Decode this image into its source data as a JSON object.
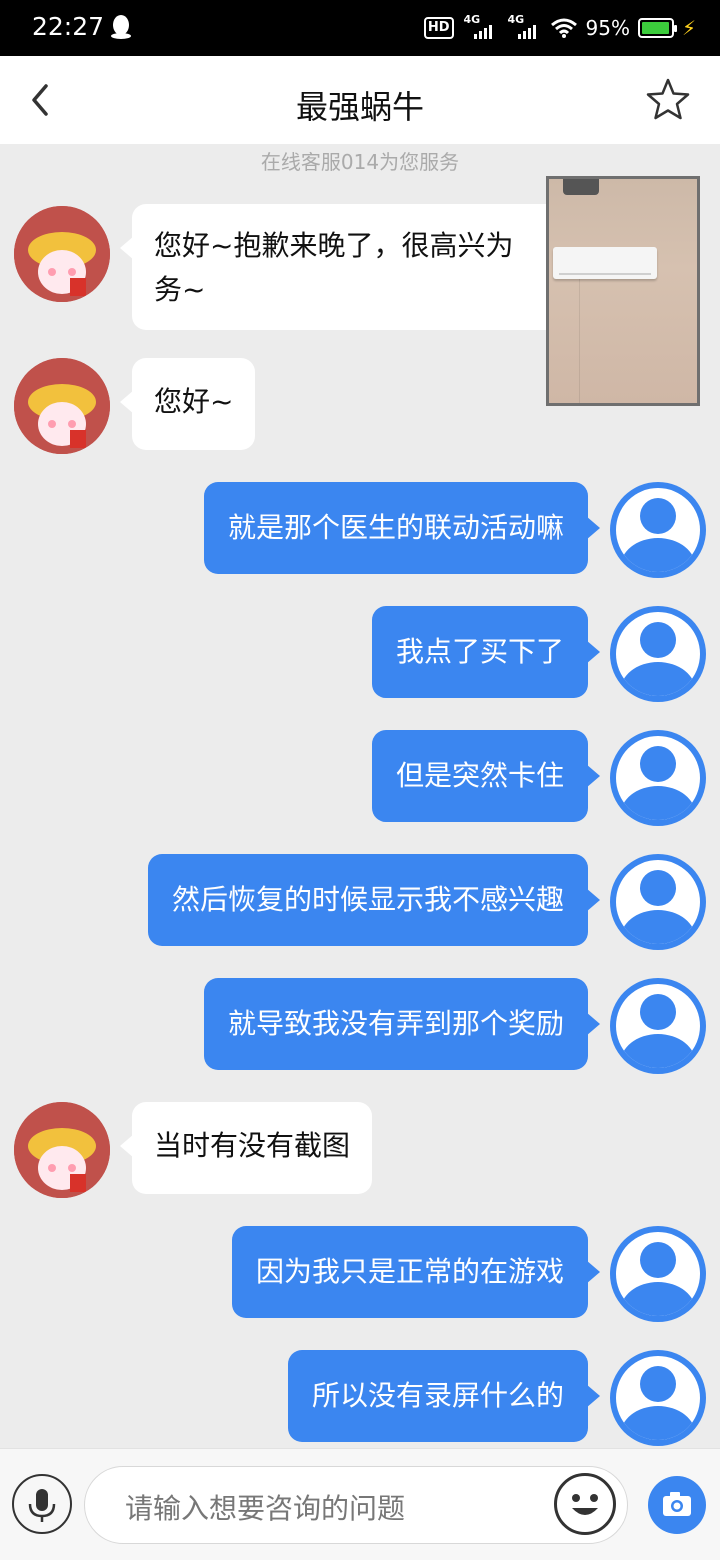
{
  "status_bar": {
    "time": "22:27",
    "hd_label": "HD",
    "network_1": "4G",
    "network_2": "4G",
    "battery_percent": "95%"
  },
  "header": {
    "title": "最强蜗牛"
  },
  "chat": {
    "service_note": "在线客服014为您服务",
    "messages": [
      {
        "side": "left",
        "text_line1": "您好~抱歉来晚了，很高兴为",
        "text_line2": "务~"
      },
      {
        "side": "left",
        "text": "您好~"
      },
      {
        "side": "right",
        "text": "就是那个医生的联动活动嘛"
      },
      {
        "side": "right",
        "text": "我点了买下了"
      },
      {
        "side": "right",
        "text": "但是突然卡住"
      },
      {
        "side": "right",
        "text": "然后恢复的时候显示我不感兴趣"
      },
      {
        "side": "right",
        "text": "就导致我没有弄到那个奖励"
      },
      {
        "side": "left",
        "text": "当时有没有截图"
      },
      {
        "side": "right",
        "text": "因为我只是正常的在游戏"
      },
      {
        "side": "right",
        "text": "所以没有录屏什么的"
      }
    ]
  },
  "input_bar": {
    "placeholder": "请输入想要咨询的问题"
  },
  "colors": {
    "accent": "#3b86f0",
    "chat_background": "#ececec",
    "bubble_left": "#ffffff"
  },
  "icons": [
    "qq-icon",
    "back-icon",
    "star-icon",
    "mic-icon",
    "emoji-icon",
    "camera-icon",
    "user-avatar-icon",
    "agent-avatar"
  ]
}
